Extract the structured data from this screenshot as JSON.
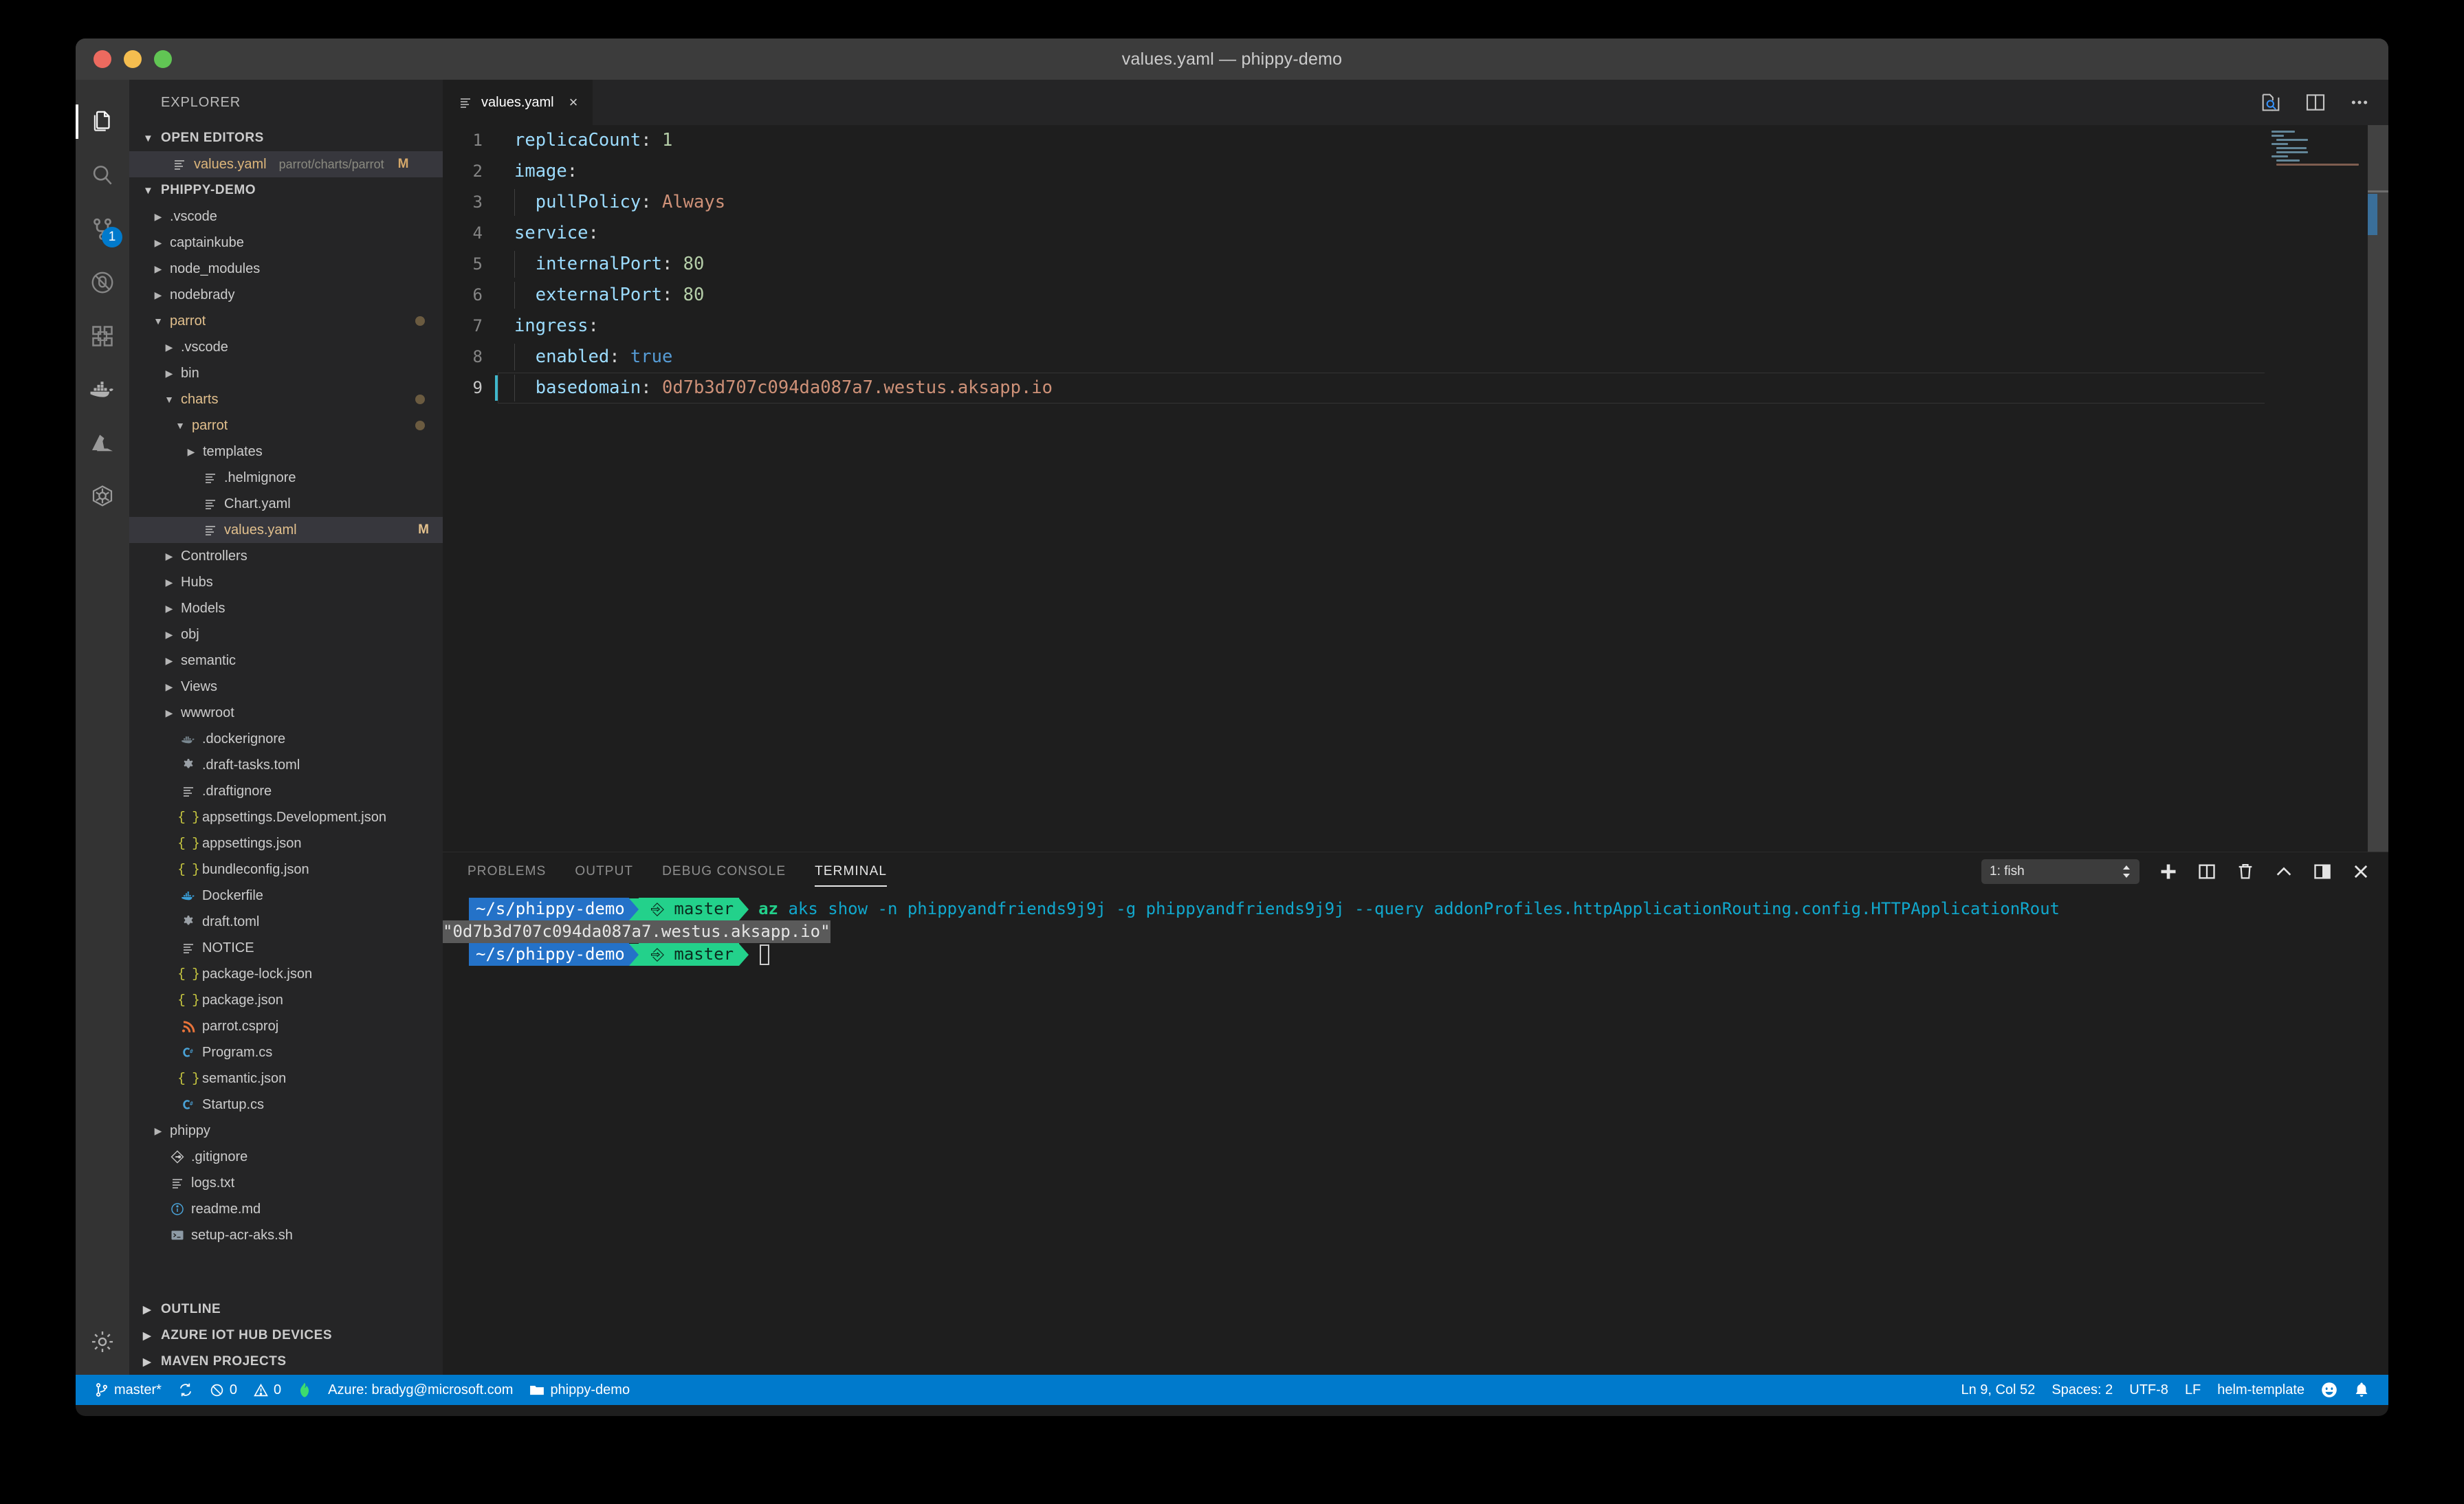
{
  "window": {
    "title": "values.yaml — phippy-demo",
    "traffic_lights": [
      "close",
      "minimize",
      "zoom"
    ]
  },
  "activity_bar": {
    "items": [
      {
        "name": "explorer",
        "icon": "files-icon",
        "active": true,
        "badge": null
      },
      {
        "name": "search",
        "icon": "search-icon",
        "active": false,
        "badge": null
      },
      {
        "name": "source-control",
        "icon": "source-control-icon",
        "active": false,
        "badge": "1"
      },
      {
        "name": "debug",
        "icon": "debug-icon",
        "active": false,
        "badge": null
      },
      {
        "name": "extensions",
        "icon": "extensions-icon",
        "active": false,
        "badge": null
      },
      {
        "name": "docker",
        "icon": "docker-icon",
        "active": false,
        "badge": null
      },
      {
        "name": "azure",
        "icon": "azure-icon",
        "active": false,
        "badge": null
      },
      {
        "name": "kubernetes",
        "icon": "kubernetes-icon",
        "active": false,
        "badge": null
      }
    ],
    "manage": {
      "icon": "gear-icon"
    }
  },
  "sidebar": {
    "title": "EXPLORER",
    "open_editors": {
      "header": "OPEN EDITORS",
      "items": [
        {
          "name": "values.yaml",
          "path": "parrot/charts/parrot",
          "status": "M",
          "icon": "yaml-icon",
          "selected": true
        }
      ]
    },
    "project": {
      "header": "PHIPPY-DEMO",
      "tree": [
        {
          "label": ".vscode",
          "indent": 1,
          "type": "folder",
          "expanded": false
        },
        {
          "label": "captainkube",
          "indent": 1,
          "type": "folder",
          "expanded": false
        },
        {
          "label": "node_modules",
          "indent": 1,
          "type": "folder",
          "expanded": false
        },
        {
          "label": "nodebrady",
          "indent": 1,
          "type": "folder",
          "expanded": false
        },
        {
          "label": "parrot",
          "indent": 1,
          "type": "folder",
          "expanded": true,
          "modified": true
        },
        {
          "label": ".vscode",
          "indent": 2,
          "type": "folder",
          "expanded": false
        },
        {
          "label": "bin",
          "indent": 2,
          "type": "folder",
          "expanded": false
        },
        {
          "label": "charts",
          "indent": 2,
          "type": "folder",
          "expanded": true,
          "modified": true
        },
        {
          "label": "parrot",
          "indent": 3,
          "type": "folder",
          "expanded": true,
          "modified": true
        },
        {
          "label": "templates",
          "indent": 4,
          "type": "folder",
          "expanded": false
        },
        {
          "label": ".helmignore",
          "indent": 4,
          "type": "file",
          "icon": "yaml-icon"
        },
        {
          "label": "Chart.yaml",
          "indent": 4,
          "type": "file",
          "icon": "yaml-icon"
        },
        {
          "label": "values.yaml",
          "indent": 4,
          "type": "file",
          "icon": "yaml-icon",
          "status": "M",
          "selected": true,
          "modified": true
        },
        {
          "label": "Controllers",
          "indent": 2,
          "type": "folder",
          "expanded": false
        },
        {
          "label": "Hubs",
          "indent": 2,
          "type": "folder",
          "expanded": false
        },
        {
          "label": "Models",
          "indent": 2,
          "type": "folder",
          "expanded": false
        },
        {
          "label": "obj",
          "indent": 2,
          "type": "folder",
          "expanded": false
        },
        {
          "label": "semantic",
          "indent": 2,
          "type": "folder",
          "expanded": false
        },
        {
          "label": "Views",
          "indent": 2,
          "type": "folder",
          "expanded": false
        },
        {
          "label": "wwwroot",
          "indent": 2,
          "type": "folder",
          "expanded": false
        },
        {
          "label": ".dockerignore",
          "indent": 2,
          "type": "file",
          "icon": "docker-gray-icon"
        },
        {
          "label": ".draft-tasks.toml",
          "indent": 2,
          "type": "file",
          "icon": "gear-file-icon"
        },
        {
          "label": ".draftignore",
          "indent": 2,
          "type": "file",
          "icon": "text-icon"
        },
        {
          "label": "appsettings.Development.json",
          "indent": 2,
          "type": "file",
          "icon": "json-icon"
        },
        {
          "label": "appsettings.json",
          "indent": 2,
          "type": "file",
          "icon": "json-icon"
        },
        {
          "label": "bundleconfig.json",
          "indent": 2,
          "type": "file",
          "icon": "json-icon"
        },
        {
          "label": "Dockerfile",
          "indent": 2,
          "type": "file",
          "icon": "docker-blue-icon"
        },
        {
          "label": "draft.toml",
          "indent": 2,
          "type": "file",
          "icon": "gear-file-icon"
        },
        {
          "label": "NOTICE",
          "indent": 2,
          "type": "file",
          "icon": "text-icon"
        },
        {
          "label": "package-lock.json",
          "indent": 2,
          "type": "file",
          "icon": "json-icon"
        },
        {
          "label": "package.json",
          "indent": 2,
          "type": "file",
          "icon": "json-icon"
        },
        {
          "label": "parrot.csproj",
          "indent": 2,
          "type": "file",
          "icon": "xml-icon"
        },
        {
          "label": "Program.cs",
          "indent": 2,
          "type": "file",
          "icon": "csharp-icon"
        },
        {
          "label": "semantic.json",
          "indent": 2,
          "type": "file",
          "icon": "json-icon"
        },
        {
          "label": "Startup.cs",
          "indent": 2,
          "type": "file",
          "icon": "csharp-icon"
        },
        {
          "label": "phippy",
          "indent": 1,
          "type": "folder",
          "expanded": false
        },
        {
          "label": ".gitignore",
          "indent": 1,
          "type": "file",
          "icon": "git-icon"
        },
        {
          "label": "logs.txt",
          "indent": 1,
          "type": "file",
          "icon": "text-icon"
        },
        {
          "label": "readme.md",
          "indent": 1,
          "type": "file",
          "icon": "info-icon"
        },
        {
          "label": "setup-acr-aks.sh",
          "indent": 1,
          "type": "file",
          "icon": "shell-icon"
        }
      ]
    },
    "bottom_sections": [
      {
        "label": "OUTLINE"
      },
      {
        "label": "AZURE IOT HUB DEVICES"
      },
      {
        "label": "MAVEN PROJECTS"
      }
    ]
  },
  "editor": {
    "tabs": [
      {
        "label": "values.yaml",
        "icon": "yaml-icon",
        "close": "×",
        "active": true
      }
    ],
    "actions": [
      {
        "name": "open-preview",
        "icon": "preview-icon"
      },
      {
        "name": "split-editor",
        "icon": "split-editor-icon"
      },
      {
        "name": "more-actions",
        "icon": "ellipsis-icon"
      }
    ],
    "lines": [
      {
        "n": "1",
        "tokens": [
          {
            "t": "replicaCount",
            "c": "k"
          },
          {
            "t": ": ",
            "c": "p"
          },
          {
            "t": "1",
            "c": "num"
          }
        ]
      },
      {
        "n": "2",
        "tokens": [
          {
            "t": "image",
            "c": "k"
          },
          {
            "t": ":",
            "c": "p"
          }
        ]
      },
      {
        "n": "3",
        "tokens": [
          {
            "t": "  ",
            "c": "p"
          },
          {
            "t": "pullPolicy",
            "c": "k"
          },
          {
            "t": ": ",
            "c": "p"
          },
          {
            "t": "Always",
            "c": "str"
          }
        ]
      },
      {
        "n": "4",
        "tokens": [
          {
            "t": "service",
            "c": "k"
          },
          {
            "t": ":",
            "c": "p"
          }
        ]
      },
      {
        "n": "5",
        "tokens": [
          {
            "t": "  ",
            "c": "p"
          },
          {
            "t": "internalPort",
            "c": "k"
          },
          {
            "t": ": ",
            "c": "p"
          },
          {
            "t": "80",
            "c": "num"
          }
        ]
      },
      {
        "n": "6",
        "tokens": [
          {
            "t": "  ",
            "c": "p"
          },
          {
            "t": "externalPort",
            "c": "k"
          },
          {
            "t": ": ",
            "c": "p"
          },
          {
            "t": "80",
            "c": "num"
          }
        ]
      },
      {
        "n": "7",
        "tokens": [
          {
            "t": "ingress",
            "c": "k"
          },
          {
            "t": ":",
            "c": "p"
          }
        ]
      },
      {
        "n": "8",
        "tokens": [
          {
            "t": "  ",
            "c": "p"
          },
          {
            "t": "enabled",
            "c": "k"
          },
          {
            "t": ": ",
            "c": "p"
          },
          {
            "t": "true",
            "c": "bool"
          }
        ]
      },
      {
        "n": "9",
        "current": true,
        "tokens": [
          {
            "t": "  ",
            "c": "p"
          },
          {
            "t": "basedomain",
            "c": "k"
          },
          {
            "t": ": ",
            "c": "p"
          },
          {
            "t": "0d7b3d707c094da087a7.westus.aksapp.io",
            "c": "str"
          }
        ]
      }
    ]
  },
  "panel": {
    "tabs": [
      {
        "label": "PROBLEMS",
        "active": false
      },
      {
        "label": "OUTPUT",
        "active": false
      },
      {
        "label": "DEBUG CONSOLE",
        "active": false
      },
      {
        "label": "TERMINAL",
        "active": true
      }
    ],
    "terminal_select": {
      "value": "1: fish"
    },
    "actions": [
      {
        "name": "new-terminal",
        "icon": "plus-icon"
      },
      {
        "name": "split-terminal",
        "icon": "split-icon"
      },
      {
        "name": "kill-terminal",
        "icon": "trash-icon"
      },
      {
        "name": "collapse-panel",
        "icon": "chevron-up-icon"
      },
      {
        "name": "maximize-panel",
        "icon": "maximize-panel-icon"
      },
      {
        "name": "close-panel",
        "icon": "close-icon"
      }
    ],
    "terminal": {
      "prompt_path": "~/s/phippy-demo",
      "prompt_branch": "master",
      "command_head": "az",
      "command_rest": " aks show -n phippyandfriends9j9j -g phippyandfriends9j9j --query addonProfiles.httpApplicationRouting.config.HTTPApplicationRout",
      "output_selected": "\"0d7b3d707c094da087a7.westus.aksapp.io\""
    }
  },
  "status_bar": {
    "left": [
      {
        "name": "branch",
        "icon": "git-branch-icon",
        "label": "master*"
      },
      {
        "name": "sync",
        "icon": "sync-icon",
        "label": ""
      },
      {
        "name": "errors",
        "icon": "error-icon",
        "label": "0"
      },
      {
        "name": "warnings",
        "icon": "warning-icon",
        "label": "0"
      },
      {
        "name": "flame",
        "icon": "flame-icon",
        "label": ""
      },
      {
        "name": "azure-account",
        "icon": "",
        "label": "Azure: bradyg@microsoft.com"
      },
      {
        "name": "workspace",
        "icon": "folder-icon",
        "label": "phippy-demo"
      }
    ],
    "right": [
      {
        "name": "cursor-position",
        "label": "Ln 9, Col 52"
      },
      {
        "name": "indentation",
        "label": "Spaces: 2"
      },
      {
        "name": "encoding",
        "label": "UTF-8"
      },
      {
        "name": "eol",
        "label": "LF"
      },
      {
        "name": "language-mode",
        "label": "helm-template"
      },
      {
        "name": "feedback",
        "icon": "smiley-icon",
        "label": ""
      },
      {
        "name": "notifications",
        "icon": "bell-icon",
        "label": ""
      }
    ]
  },
  "colors": {
    "accent": "#007acc",
    "modified": "#e2c08d",
    "terminal_blue": "#2472c8",
    "terminal_green": "#23d18b",
    "string": "#ce9178",
    "key": "#9cdcfe"
  }
}
